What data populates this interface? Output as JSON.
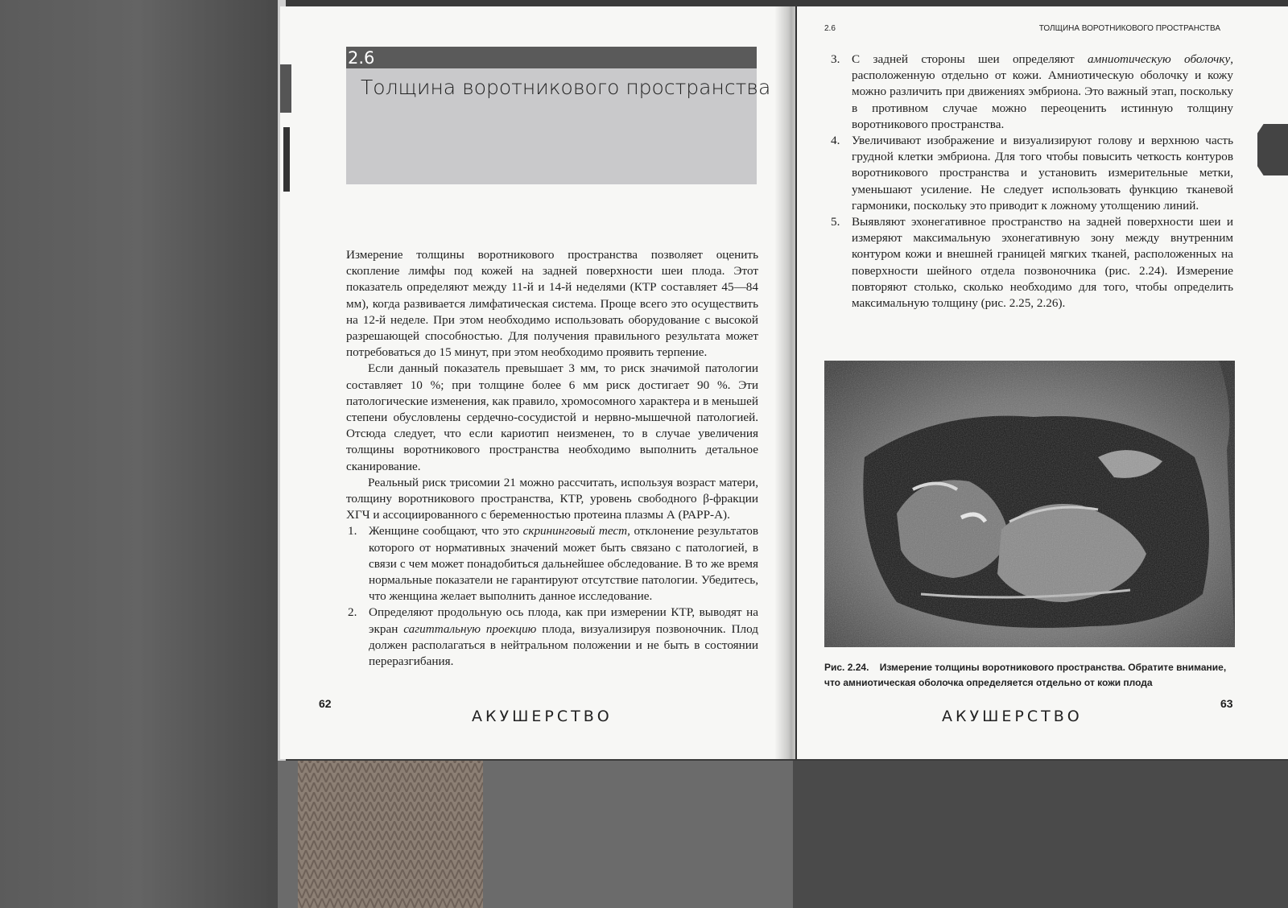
{
  "left_page": {
    "section_number": "2.6",
    "section_title": "Толщина воротникового пространства",
    "paragraphs": [
      "Измерение толщины воротникового пространства позволяет оценить скопление лимфы под кожей на задней поверхности шеи плода. Этот показатель определяют между 11-й и 14-й неделями (КТР составляет 45—84 мм), когда развивается лимфатическая система. Проще всего это осуществить на 12-й неделе. При этом необходимо использовать оборудование с высокой разрешающей способностью. Для получения правильного результата может потребоваться до 15 минут, при этом необходимо проявить терпение.",
      "Если данный показатель превышает 3 мм, то риск значимой патологии составляет 10 %; при толщине более 6 мм риск достигает 90 %. Эти патологические изменения, как правило, хромосомного характера и в меньшей степени обусловлены сердечно-сосудистой и нервно-мышечной патологией. Отсюда следует, что если кариотип неизменен, то в случае увеличения толщины воротникового пространства необходимо выполнить детальное сканирование.",
      "Реальный риск трисомии 21 можно рассчитать, используя возраст матери, толщину воротникового пространства, КТР, уровень свободного β-фракции ХГЧ и ассоциированного с беременностью протеина плазмы А (РАРР-А)."
    ],
    "list": [
      {
        "num": "1.",
        "before": "Женщине сообщают, что это ",
        "em": "скрининговый тест",
        "after": ", отклонение результатов которого от нормативных значений может быть связано с патологией, в связи с чем может понадобиться дальнейшее обследование. В то же время нормальные показатели не гарантируют отсутствие патологии. Убедитесь, что женщина желает выполнить данное исследование."
      },
      {
        "num": "2.",
        "before": "Определяют продольную ось плода, как при измерении КТР, выводят на экран ",
        "em": "сагиттальную проекцию",
        "after": " плода, визуализируя позвоночник. Плод должен располагаться в нейтральном положении и не быть в состоянии переразгибания."
      }
    ],
    "page_number": "62",
    "footer": "АКУШЕРСТВО"
  },
  "right_page": {
    "running_number": "2.6",
    "running_title": "ТОЛЩИНА ВОРОТНИКОВОГО ПРОСТРАНСТВА",
    "list": [
      {
        "num": "3.",
        "before": "С задней стороны шеи определяют ",
        "em": "амниотическую оболочку",
        "after": ", расположенную отдельно от кожи. Амниотическую оболочку и кожу можно различить при движениях эмбриона. Это важный этап, поскольку в противном случае можно переоценить истинную толщину воротникового пространства."
      },
      {
        "num": "4.",
        "before": "Увеличивают изображение и визуализируют голову и верхнюю часть грудной клетки эмбриона. Для того чтобы повысить четкость контуров воротникового пространства и установить измерительные метки, уменьшают усиление. Не следует использовать функцию тканевой гармоники, поскольку это приводит к ложному утолщению линий.",
        "em": "",
        "after": ""
      },
      {
        "num": "5.",
        "before": "Выявляют эхонегативное пространство на задней поверхности шеи и измеряют максимальную эхонегативную зону между внутренним контуром кожи и внешней границей мягких тканей, расположенных на поверхности шейного отдела позвоночника (рис. 2.24). Измерение повторяют столько, сколько необходимо для того, чтобы определить максимальную толщину (рис. 2.25, 2.26).",
        "em": "",
        "after": ""
      }
    ],
    "figure_label": "Рис. 2.24.",
    "figure_caption": "Измерение толщины воротникового пространства. Обратите внимание, что амниотическая оболочка определяется отдельно от кожи плода",
    "page_number": "63",
    "footer": "АКУШЕРСТВО"
  }
}
